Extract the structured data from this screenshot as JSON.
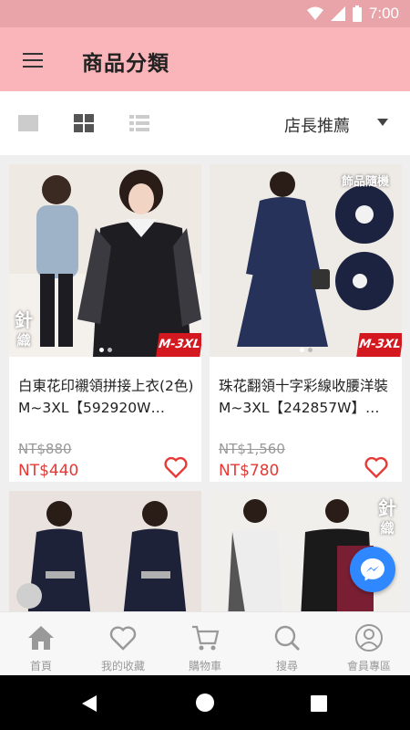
{
  "status_bar": {
    "time": "7:00"
  },
  "header": {
    "title": "商品分類"
  },
  "toolbar": {
    "sort_label": "店長推薦"
  },
  "products": [
    {
      "name": "白東花印襯領拼接上衣(2色) M~3XL【592920W…",
      "original_price": "NT$880",
      "price": "NT$440",
      "badge": "M-3XL",
      "tag": "針織"
    },
    {
      "name": "珠花翻領十字彩線收腰洋裝 M~3XL【242857W】…",
      "original_price": "NT$1,560",
      "price": "NT$780",
      "badge": "M-3XL",
      "tag": "飾品隨機"
    },
    {
      "tag": ""
    },
    {
      "tag": "針織"
    }
  ],
  "bottom_nav": [
    {
      "label": "首頁",
      "icon": "home-icon"
    },
    {
      "label": "我的收藏",
      "icon": "heart-icon"
    },
    {
      "label": "購物車",
      "icon": "cart-icon"
    },
    {
      "label": "搜尋",
      "icon": "search-icon"
    },
    {
      "label": "會員專區",
      "icon": "user-icon"
    }
  ],
  "colors": {
    "status_bar": "#e8a4a8",
    "app_bar": "#f9b5b9",
    "price": "#e53935",
    "heart": "#e53935",
    "messenger": "#2f88ff"
  }
}
